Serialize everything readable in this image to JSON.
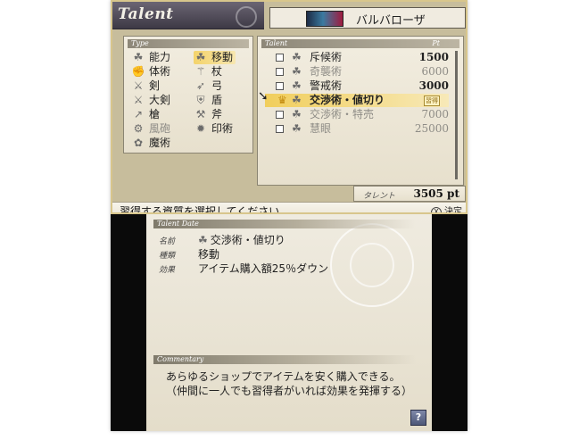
{
  "header": {
    "title": "Talent",
    "character_name": "バルバローザ"
  },
  "type_panel": {
    "heading": "Type",
    "items": [
      {
        "label": "能力",
        "icon": "ability-icon",
        "glyph": "☘",
        "selected": false,
        "dim": false
      },
      {
        "label": "移動",
        "icon": "movement-icon",
        "glyph": "☘",
        "selected": true,
        "dim": false
      },
      {
        "label": "体術",
        "icon": "martial-arts-icon",
        "glyph": "✊",
        "selected": false,
        "dim": false
      },
      {
        "label": "杖",
        "icon": "staff-icon",
        "glyph": "⚚",
        "selected": false,
        "dim": false
      },
      {
        "label": "剣",
        "icon": "sword-icon",
        "glyph": "⚔",
        "selected": false,
        "dim": false
      },
      {
        "label": "弓",
        "icon": "bow-icon",
        "glyph": "➶",
        "selected": false,
        "dim": false
      },
      {
        "label": "大剣",
        "icon": "greatsword-icon",
        "glyph": "⚔",
        "selected": false,
        "dim": false
      },
      {
        "label": "盾",
        "icon": "shield-icon",
        "glyph": "⛨",
        "selected": false,
        "dim": false
      },
      {
        "label": "槍",
        "icon": "spear-icon",
        "glyph": "↗",
        "selected": false,
        "dim": false
      },
      {
        "label": "斧",
        "icon": "axe-icon",
        "glyph": "⚒",
        "selected": false,
        "dim": false
      },
      {
        "label": "風砲",
        "icon": "wind-cannon-icon",
        "glyph": "⚙",
        "selected": false,
        "dim": true
      },
      {
        "label": "印術",
        "icon": "seal-art-icon",
        "glyph": "✹",
        "selected": false,
        "dim": false
      },
      {
        "label": "魔術",
        "icon": "magic-icon",
        "glyph": "✿",
        "selected": false,
        "dim": false
      }
    ]
  },
  "talent_panel": {
    "heading": "Talent",
    "pt_heading": "Pt",
    "rows": [
      {
        "name": "斥候術",
        "pt": "1500",
        "dim": false,
        "selected": false
      },
      {
        "name": "奇襲術",
        "pt": "6000",
        "dim": true,
        "selected": false
      },
      {
        "name": "警戒術",
        "pt": "3000",
        "dim": false,
        "selected": false
      },
      {
        "name": "交渉術・値切り",
        "pt": "",
        "dim": false,
        "selected": true,
        "badge": "習得"
      },
      {
        "name": "交渉術・特売",
        "pt": "7000",
        "dim": true,
        "selected": false
      },
      {
        "name": "慧眼",
        "pt": "25000",
        "dim": true,
        "selected": false
      }
    ]
  },
  "total": {
    "label": "タレント",
    "value": "3505 pt"
  },
  "instruction": {
    "text": "習得する資質を選択してください",
    "button_label": "決定",
    "button_glyph": "X"
  },
  "detail": {
    "heading": "Talent Date",
    "name_key": "名前",
    "name": "交渉術・値切り",
    "type_key": "種類",
    "type": "移動",
    "effect_key": "効果",
    "effect": "アイテム購入額25％ダウン"
  },
  "commentary": {
    "heading": "Commentary",
    "line1": "あらゆるショップでアイテムを安く購入できる。",
    "line2": "（仲間に一人でも習得者がいれば効果を発揮する）"
  },
  "help": {
    "glyph": "?"
  },
  "colors": {
    "highlight": "#f1ce5c",
    "parchment": "#efebe0",
    "frame": "#0a0a0a"
  }
}
